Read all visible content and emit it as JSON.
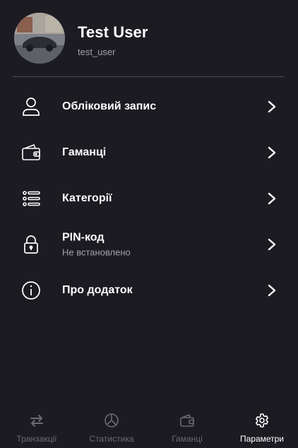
{
  "profile": {
    "name": "Test User",
    "username": "test_user"
  },
  "menu": [
    {
      "icon": "user-icon",
      "label": "Обліковий запис",
      "sublabel": ""
    },
    {
      "icon": "wallet-icon",
      "label": "Гаманці",
      "sublabel": ""
    },
    {
      "icon": "list-icon",
      "label": "Категорії",
      "sublabel": ""
    },
    {
      "icon": "lock-icon",
      "label": "PIN-код",
      "sublabel": "Не встановлено"
    },
    {
      "icon": "info-icon",
      "label": "Про додаток",
      "sublabel": ""
    }
  ],
  "bottom_nav": [
    {
      "icon": "transfer-arrows-icon",
      "label": "Транзакції",
      "active": false
    },
    {
      "icon": "pie-chart-icon",
      "label": "Статистика",
      "active": false
    },
    {
      "icon": "wallet-icon",
      "label": "Гаманці",
      "active": false
    },
    {
      "icon": "gear-icon",
      "label": "Параметри",
      "active": true
    }
  ],
  "colors": {
    "background": "#1c1b21",
    "text_primary": "#ffffff",
    "text_secondary": "#a3a2a8",
    "nav_inactive": "#6c6b72",
    "divider": "#4b4a52"
  }
}
